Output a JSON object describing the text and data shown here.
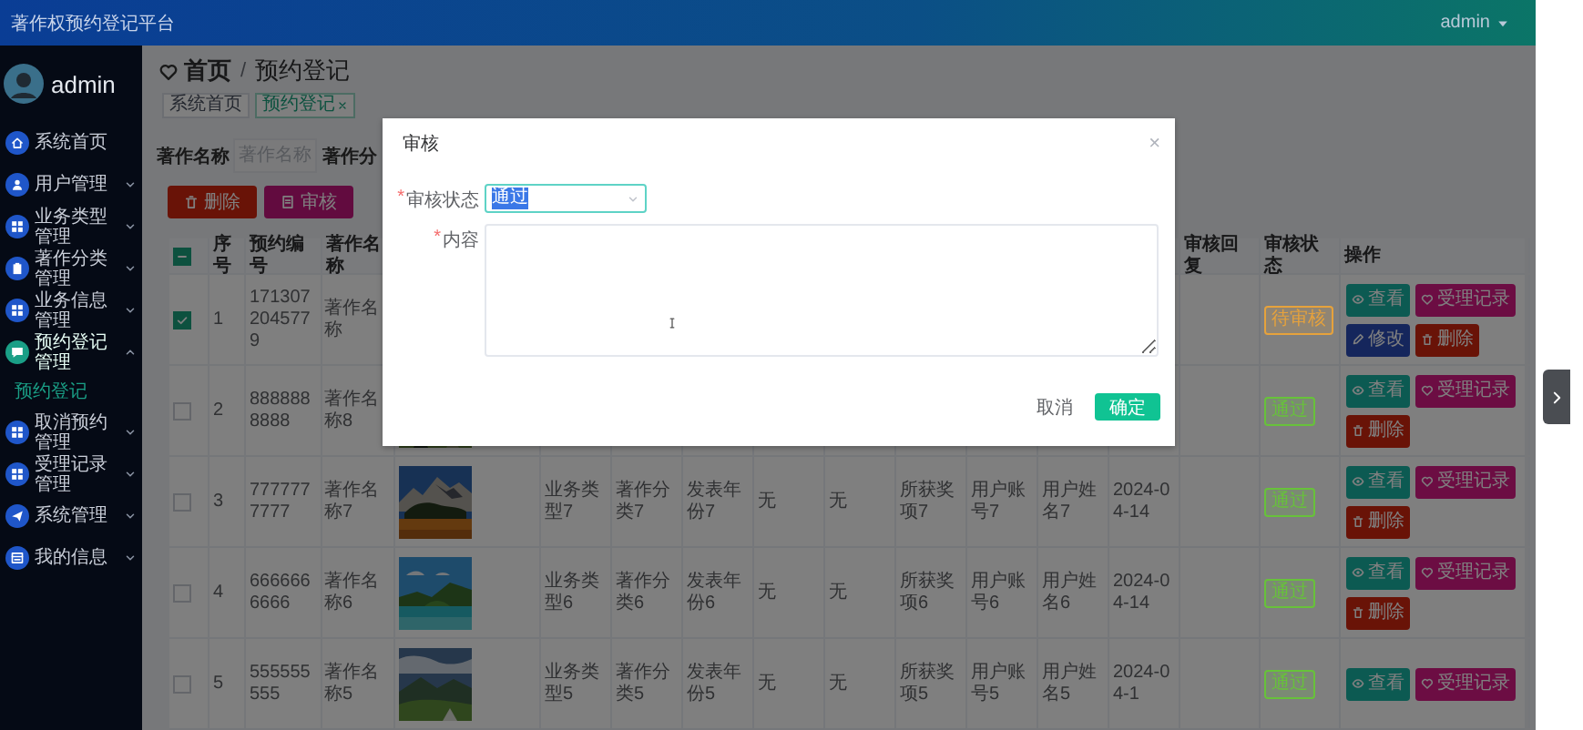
{
  "top_bar": {
    "title": "著作权预约登记平台",
    "user": "admin"
  },
  "sidebar": {
    "user": "admin",
    "menu": [
      {
        "label": "系统首页",
        "expandable": false,
        "selected": false
      },
      {
        "label": "用户管理",
        "expandable": true,
        "expanded": false,
        "selected": false
      },
      {
        "label": "业务类型管理",
        "expandable": true,
        "expanded": false,
        "selected": false
      },
      {
        "label": "著作分类管理",
        "expandable": true,
        "expanded": false,
        "selected": false
      },
      {
        "label": "业务信息管理",
        "expandable": true,
        "expanded": false,
        "selected": false
      },
      {
        "label": "预约登记管理",
        "expandable": true,
        "expanded": true,
        "selected": true,
        "children": [
          {
            "label": "预约登记",
            "selected": true
          }
        ]
      },
      {
        "label": "取消预约管理",
        "expandable": true,
        "expanded": false,
        "selected": false
      },
      {
        "label": "受理记录管理",
        "expandable": true,
        "expanded": false,
        "selected": false
      },
      {
        "label": "系统管理",
        "expandable": true,
        "expanded": false,
        "selected": false
      },
      {
        "label": "我的信息",
        "expandable": true,
        "expanded": false,
        "selected": false
      }
    ]
  },
  "breadcrumb": {
    "items": [
      "首页",
      "预约登记"
    ],
    "separator": "/"
  },
  "tags": [
    {
      "label": "系统首页",
      "selected": false,
      "closable": false
    },
    {
      "label": "预约登记",
      "selected": true,
      "closable": true
    }
  ],
  "search": {
    "fields": [
      {
        "label": "著作名称",
        "placeholder": "著作名称"
      },
      {
        "label": "著作分"
      }
    ]
  },
  "actions": [
    {
      "label": "删除",
      "kind": "delete"
    },
    {
      "label": "审核",
      "kind": "review"
    }
  ],
  "table": {
    "header_checkbox": {
      "indeterminate": true
    },
    "columns_left": [
      "序号",
      "预约编号",
      "著作名称"
    ],
    "columns_right": [
      "审核回复",
      "审核状态",
      "操作"
    ],
    "rows": [
      {
        "checked": true,
        "index": "1",
        "code": "1713072045779",
        "name": "著作名称",
        "status": {
          "text": "待审核",
          "color": "#e6a23c"
        },
        "actions": [
          {
            "label": "查看",
            "kind": "view"
          },
          {
            "label": "受理记录",
            "kind": "record"
          },
          {
            "label": "修改",
            "kind": "edit"
          },
          {
            "label": "删除",
            "kind": "delete"
          }
        ]
      },
      {
        "checked": false,
        "index": "2",
        "code": "8888888888",
        "name": "著作名称8",
        "picture": {
          "kind": "picture"
        },
        "status": {
          "text": "通过",
          "color": "#67c23a"
        },
        "actions": [
          {
            "label": "查看",
            "kind": "view"
          },
          {
            "label": "受理记录",
            "kind": "record"
          },
          {
            "label": "删除",
            "kind": "delete"
          }
        ]
      },
      {
        "checked": false,
        "index": "3",
        "code": "7777777777",
        "name": "著作名称7",
        "picture": {
          "kind": "picture"
        },
        "fields": [
          "业务类型7",
          "著作分类7",
          "发表年份7",
          "无",
          "无",
          "所获奖项7",
          "用户账号7",
          "用户姓名7",
          "2024-04-14"
        ],
        "status": {
          "text": "通过",
          "color": "#67c23a"
        },
        "actions": [
          {
            "label": "查看",
            "kind": "view"
          },
          {
            "label": "受理记录",
            "kind": "record"
          },
          {
            "label": "删除",
            "kind": "delete"
          }
        ]
      },
      {
        "checked": false,
        "index": "4",
        "code": "6666666666",
        "name": "著作名称6",
        "picture": {
          "kind": "picture"
        },
        "fields": [
          "业务类型6",
          "著作分类6",
          "发表年份6",
          "无",
          "无",
          "所获奖项6",
          "用户账号6",
          "用户姓名6",
          "2024-04-14"
        ],
        "status": {
          "text": "通过",
          "color": "#67c23a"
        },
        "actions": [
          {
            "label": "查看",
            "kind": "view"
          },
          {
            "label": "受理记录",
            "kind": "record"
          },
          {
            "label": "删除",
            "kind": "delete"
          }
        ]
      },
      {
        "checked": false,
        "index": "5",
        "code": "555555555",
        "name": "著作名称5",
        "picture": {
          "kind": "picture"
        },
        "fields": [
          "业务类型5",
          "著作分类5",
          "发表年份5",
          "无",
          "无",
          "所获奖项5",
          "用户账号5",
          "用户姓名5",
          "2024-04-1"
        ],
        "status": {
          "text": "通过",
          "color": "#67c23a"
        },
        "actions": [
          {
            "label": "查看",
            "kind": "view"
          },
          {
            "label": "受理记录",
            "kind": "record"
          }
        ]
      }
    ]
  },
  "dialog": {
    "title": "审核",
    "close": "×",
    "fields": [
      {
        "label": "审核状态",
        "mark": "*",
        "kind": "select",
        "value": "通过"
      },
      {
        "label": "内容",
        "mark": "*",
        "kind": "textarea"
      }
    ],
    "buttons": [
      {
        "label": "取消",
        "kind": "text"
      },
      {
        "label": "确定",
        "kind": "primary"
      }
    ]
  }
}
